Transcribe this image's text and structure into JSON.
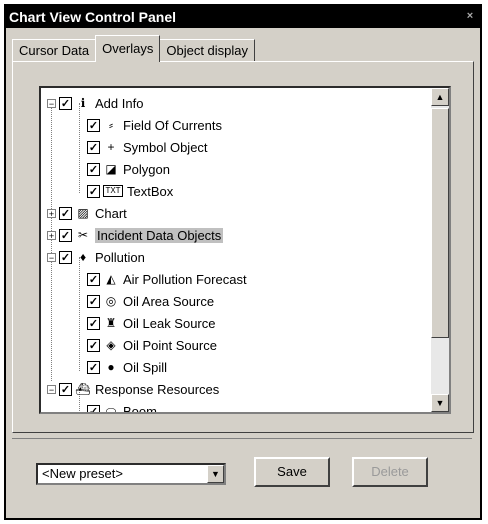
{
  "window": {
    "title": "Chart View Control Panel",
    "close_glyph": "×"
  },
  "tabs": [
    {
      "label": "Cursor Data",
      "active": false
    },
    {
      "label": "Overlays",
      "active": true
    },
    {
      "label": "Object display",
      "active": false
    }
  ],
  "tree": {
    "items": [
      {
        "label": "Add Info",
        "icon": "info-icon",
        "glyph": "ℹ",
        "checked": true,
        "expander": "−",
        "selected": false
      },
      {
        "label": "Field Of Currents",
        "icon": "currents-icon",
        "glyph": "⸗",
        "checked": true,
        "selected": false
      },
      {
        "label": "Symbol Object",
        "icon": "symbol-icon",
        "glyph": "+",
        "checked": true,
        "selected": false
      },
      {
        "label": "Polygon",
        "icon": "polygon-icon",
        "glyph": "◪",
        "checked": true,
        "selected": false
      },
      {
        "label": "TextBox",
        "icon": "textbox-icon",
        "glyph": "TXT",
        "checked": true,
        "selected": false
      },
      {
        "label": "Chart",
        "icon": "chart-icon",
        "glyph": "▨",
        "checked": true,
        "expander": "+",
        "selected": false
      },
      {
        "label": "Incident Data Objects",
        "icon": "incident-icon",
        "glyph": "✂",
        "checked": true,
        "expander": "+",
        "selected": true
      },
      {
        "label": "Pollution",
        "icon": "droplet-icon",
        "glyph": "♦",
        "checked": true,
        "expander": "−",
        "selected": false
      },
      {
        "label": "Air Pollution Forecast",
        "icon": "air-pollution-icon",
        "glyph": "◭",
        "checked": true,
        "selected": false
      },
      {
        "label": "Oil Area Source",
        "icon": "oil-area-icon",
        "glyph": "◎",
        "checked": true,
        "selected": false
      },
      {
        "label": "Oil Leak Source",
        "icon": "oil-leak-icon",
        "glyph": "♜",
        "checked": true,
        "selected": false
      },
      {
        "label": "Oil Point Source",
        "icon": "oil-point-icon",
        "glyph": "◈",
        "checked": true,
        "selected": false
      },
      {
        "label": "Oil Spill",
        "icon": "oil-spill-icon",
        "glyph": "●",
        "checked": true,
        "selected": false
      },
      {
        "label": "Response Resources",
        "icon": "ship-icon",
        "glyph": "⛴",
        "checked": true,
        "expander": "−",
        "selected": false
      },
      {
        "label": "Boom",
        "icon": "boom-icon",
        "glyph": "⬭",
        "checked": true,
        "selected": false
      }
    ]
  },
  "preset": {
    "selected": "<New preset>"
  },
  "buttons": {
    "save": "Save",
    "delete": "Delete"
  },
  "scroll": {
    "up": "▲",
    "down": "▼"
  },
  "check_glyph": "✓"
}
